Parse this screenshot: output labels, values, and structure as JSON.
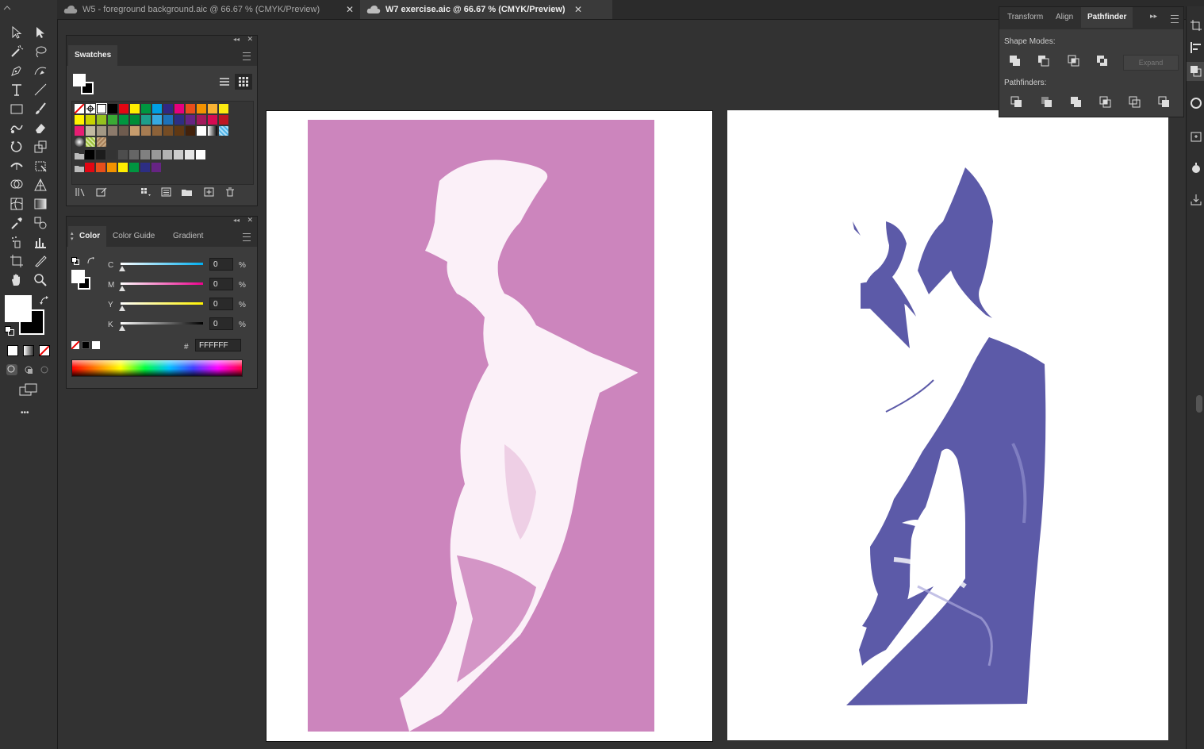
{
  "tabs": [
    {
      "label": "W5 - foreground background.aic @ 66.67 % (CMYK/Preview)",
      "close": "✕"
    },
    {
      "label": "W7 exercise.aic @ 66.67 % (CMYK/Preview)",
      "close": "✕"
    }
  ],
  "swatches_panel": {
    "title": "Swatches",
    "rows": [
      [
        "#ffffff",
        "#ffffff",
        "#ffffff",
        "#000000",
        "#e30613",
        "#ffed00",
        "#009640",
        "#009fe3",
        "#312783",
        "#e6007e",
        "#e84e1b",
        "#f39200",
        "#f9b233",
        "#fcea10"
      ],
      [
        "#fff200",
        "#c7d300",
        "#95c11f",
        "#3aaa35",
        "#00963f",
        "#008d36",
        "#1d9f8b",
        "#36a9e1",
        "#1d71b8",
        "#2d2e83",
        "#662483",
        "#a3195b",
        "#d60b52",
        "#be1622"
      ],
      [
        "#e71d73",
        "#c1b9a0",
        "#a39884",
        "#8c7a6b",
        "#6e5b4e",
        "#c69c6d",
        "#a67c52",
        "#8c6239",
        "#754c24",
        "#603813",
        "#42210b",
        "#ffffff",
        "#9d9d9c",
        "#4fb3e8"
      ],
      [
        "#555555",
        "#9dc03c",
        "#a67f59"
      ],
      [
        "#000000",
        "#1c1c1c",
        "#333333",
        "#4d4d4d",
        "#666666",
        "#808080",
        "#999999",
        "#b3b3b3",
        "#cccccc",
        "#e6e6e6",
        "#ffffff"
      ],
      [
        "#e30613",
        "#e84e1b",
        "#f39200",
        "#ffed00",
        "#009640",
        "#2d2e83",
        "#662483"
      ]
    ]
  },
  "color_panel": {
    "tabs": [
      "Color",
      "Color Guide",
      "Gradient"
    ],
    "channels": [
      {
        "name": "C",
        "value": "0",
        "unit": "%"
      },
      {
        "name": "M",
        "value": "0",
        "unit": "%"
      },
      {
        "name": "Y",
        "value": "0",
        "unit": "%"
      },
      {
        "name": "K",
        "value": "0",
        "unit": "%"
      }
    ],
    "hex_label": "#",
    "hex_value": "FFFFFF"
  },
  "pathfinder_panel": {
    "tabs": [
      "Transform",
      "Align",
      "Pathfinder"
    ],
    "shape_modes_label": "Shape Modes:",
    "pathfinders_label": "Pathfinders:",
    "expand_label": "Expand"
  },
  "toolbar": {
    "more_label": "•••",
    "tools": [
      "selection",
      "direct-selection",
      "magic-wand",
      "lasso",
      "pen",
      "curvature",
      "type",
      "line-segment",
      "rectangle",
      "paintbrush",
      "shaper",
      "eraser",
      "rotate",
      "scale",
      "width",
      "free-transform",
      "shape-builder",
      "perspective-grid",
      "mesh",
      "gradient",
      "eyedropper",
      "blend",
      "symbol-sprayer",
      "column-graph",
      "artboard",
      "slice",
      "hand",
      "zoom"
    ]
  },
  "colors": {
    "pink_background": "#cc85bd",
    "purple_figure": "#5c5aa8",
    "ui_bg": "#323232"
  }
}
